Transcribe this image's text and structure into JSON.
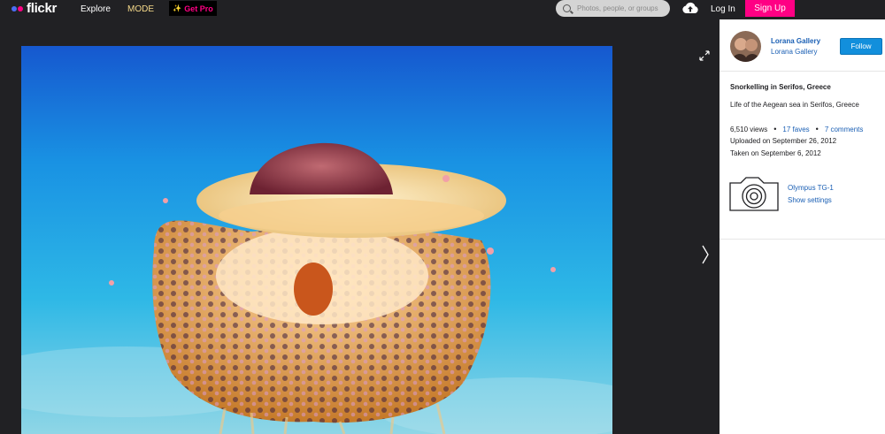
{
  "header": {
    "logo_text": "flickr",
    "nav_explore": "Explore",
    "nav_mode": "MODE",
    "get_pro": "Get Pro",
    "search_placeholder": "Photos, people, or groups",
    "login": "Log In",
    "signup": "Sign Up"
  },
  "owner": {
    "name": "Lorana Gallery",
    "subtitle": "Lorana Gallery",
    "follow_label": "Follow"
  },
  "photo": {
    "title": "Snorkelling in Serifos, Greece",
    "description": "Life of the Aegean sea in Serifos, Greece",
    "views": "6,510 views",
    "faves": "17 faves",
    "comments": "7 comments",
    "uploaded": "Uploaded on September 26, 2012",
    "taken": "Taken on September 6, 2012"
  },
  "camera": {
    "model": "Olympus TG-1",
    "settings_link": "Show settings"
  },
  "colors": {
    "brand_pink": "#ff0084",
    "brand_blue": "#4b6ef5",
    "link_blue": "#1a5fb4",
    "follow_blue": "#128fdc"
  }
}
